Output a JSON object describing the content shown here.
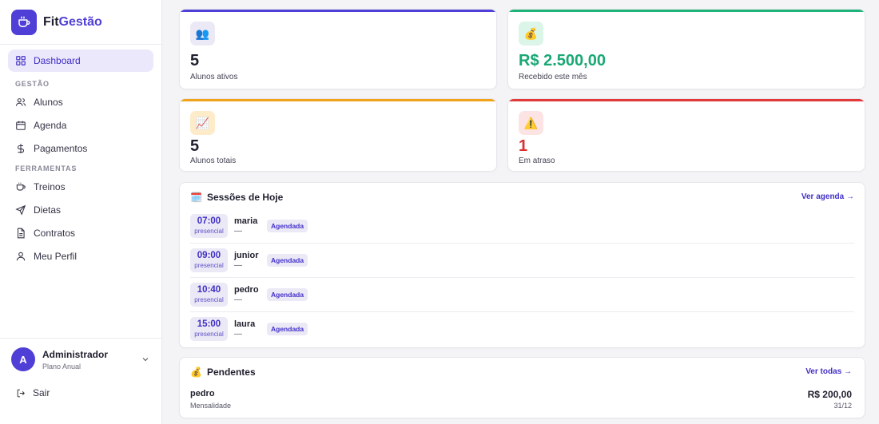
{
  "brand": {
    "name_part1": "Fit",
    "name_part2": "Gestão",
    "color": "#4f3fd6"
  },
  "sidebar": {
    "dashboard": {
      "label": "Dashboard",
      "icon": "grid-icon"
    },
    "sections": [
      {
        "title": "GESTÃO",
        "items": [
          {
            "label": "Alunos",
            "icon": "users-icon"
          },
          {
            "label": "Agenda",
            "icon": "calendar-icon"
          },
          {
            "label": "Pagamentos",
            "icon": "dollar-icon"
          }
        ]
      },
      {
        "title": "FERRAMENTAS",
        "items": [
          {
            "label": "Treinos",
            "icon": "cup-icon"
          },
          {
            "label": "Dietas",
            "icon": "send-icon"
          },
          {
            "label": "Contratos",
            "icon": "document-icon"
          },
          {
            "label": "Meu Perfil",
            "icon": "user-icon"
          }
        ]
      }
    ],
    "user": {
      "initial": "A",
      "name": "Administrador",
      "plan": "Plano Anual"
    },
    "logout": "Sair"
  },
  "stats": [
    {
      "value": "5",
      "label": "Alunos ativos",
      "icon": "👥",
      "color": "#4f3fd6",
      "value_color": "#1f1f2e",
      "icon_bg": "#ebe9f6"
    },
    {
      "value": "R$ 2.500,00",
      "label": "Recebido este mês",
      "icon": "💰",
      "color": "#1fb37a",
      "value_color": "#19a874",
      "icon_bg": "#dcf5e9"
    },
    {
      "value": "5",
      "label": "Alunos totais",
      "icon": "📈",
      "color": "#f0a21a",
      "value_color": "#1f1f2e",
      "icon_bg": "#fdebc9"
    },
    {
      "value": "1",
      "label": "Em atraso",
      "icon": "⚠️",
      "color": "#e03a3a",
      "value_color": "#d93030",
      "icon_bg": "#fde4e4"
    }
  ],
  "sessions": {
    "title": "Sessões de Hoje",
    "icon": "🗓️",
    "link": "Ver agenda →",
    "items": [
      {
        "time": "07:00",
        "mode": "presencial",
        "name": "maria",
        "sub": "—",
        "status": "Agendada"
      },
      {
        "time": "09:00",
        "mode": "presencial",
        "name": "junior",
        "sub": "—",
        "status": "Agendada"
      },
      {
        "time": "10:40",
        "mode": "presencial",
        "name": "pedro",
        "sub": "—",
        "status": "Agendada"
      },
      {
        "time": "15:00",
        "mode": "presencial",
        "name": "laura",
        "sub": "—",
        "status": "Agendada"
      }
    ]
  },
  "pending": {
    "title": "Pendentes",
    "icon": "💰",
    "link": "Ver todas →",
    "items": [
      {
        "name": "pedro",
        "type": "Mensalidade",
        "amount": "R$ 200,00",
        "date": "31/12"
      }
    ]
  }
}
